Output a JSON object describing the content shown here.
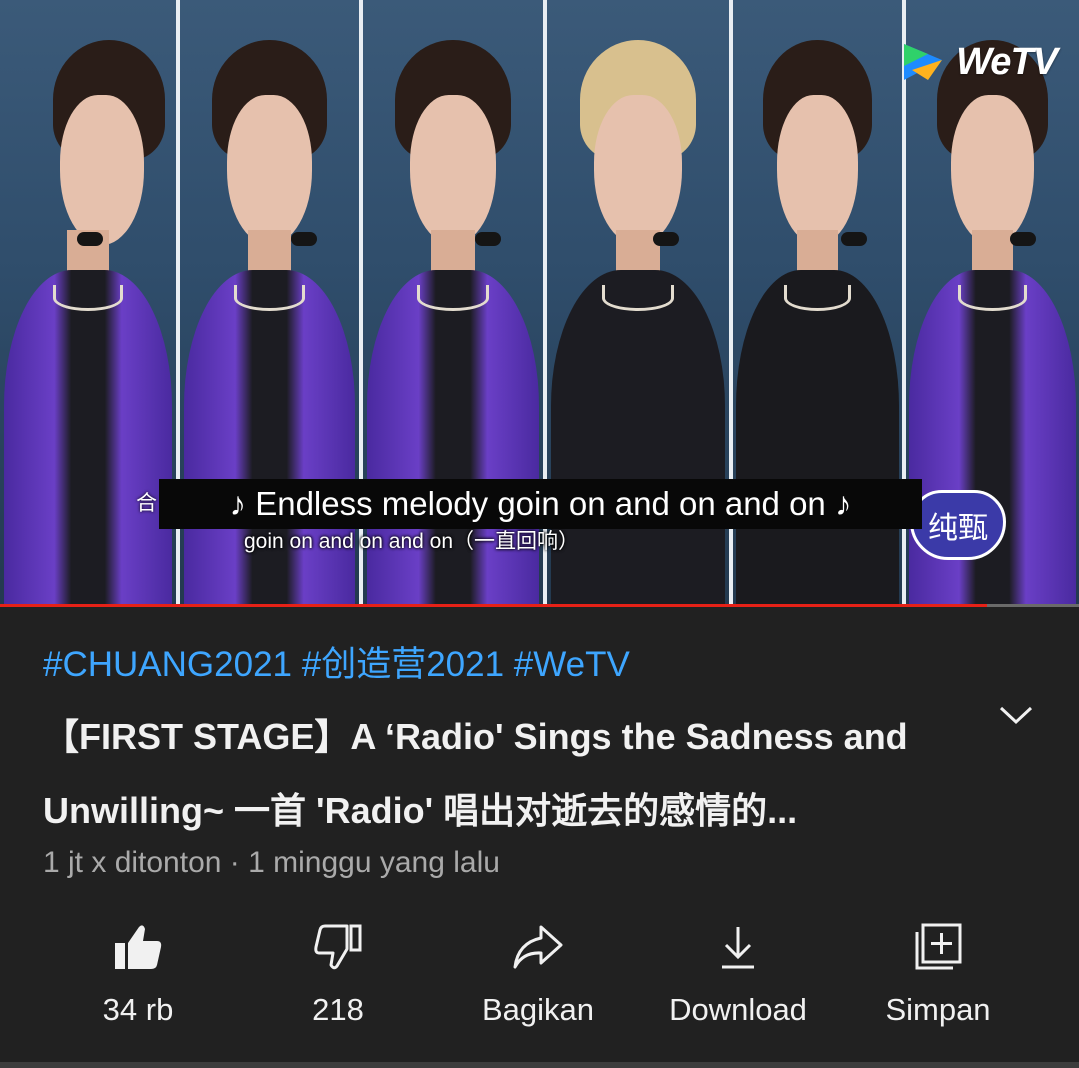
{
  "player": {
    "watermark": "WeTV",
    "caption": "♪ Endless melody goin on and on and on ♪",
    "burned_subtitle": "goin on and on and on（一直回响）",
    "burned_left_char": "合",
    "badge_text": "纯甄",
    "progress_fraction": 0.915,
    "colors": {
      "progress": "#e62117",
      "wetv_green": "#2fd16a",
      "wetv_blue": "#1e8bff"
    }
  },
  "video": {
    "hashtags": "#CHUANG2021 #创造营2021 #WeTV",
    "title": "【FIRST STAGE】A ‘Radio' Sings the Sadness and Unwilling~ 一首 'Radio' 唱出对逝去的感情的...",
    "meta": "1 jt x ditonton · 1 minggu yang lalu",
    "expand_icon": "chevron-down-icon"
  },
  "actions": [
    {
      "icon": "thumbs-up-icon",
      "label": "34 rb"
    },
    {
      "icon": "thumbs-down-icon",
      "label": "218"
    },
    {
      "icon": "share-icon",
      "label": "Bagikan"
    },
    {
      "icon": "download-icon",
      "label": "Download"
    },
    {
      "icon": "add-to-playlist-icon",
      "label": "Simpan"
    }
  ],
  "theme": {
    "background": "#212121",
    "link": "#3ea6ff",
    "text": "#f1f1f1",
    "secondary": "#aaaaaa"
  }
}
